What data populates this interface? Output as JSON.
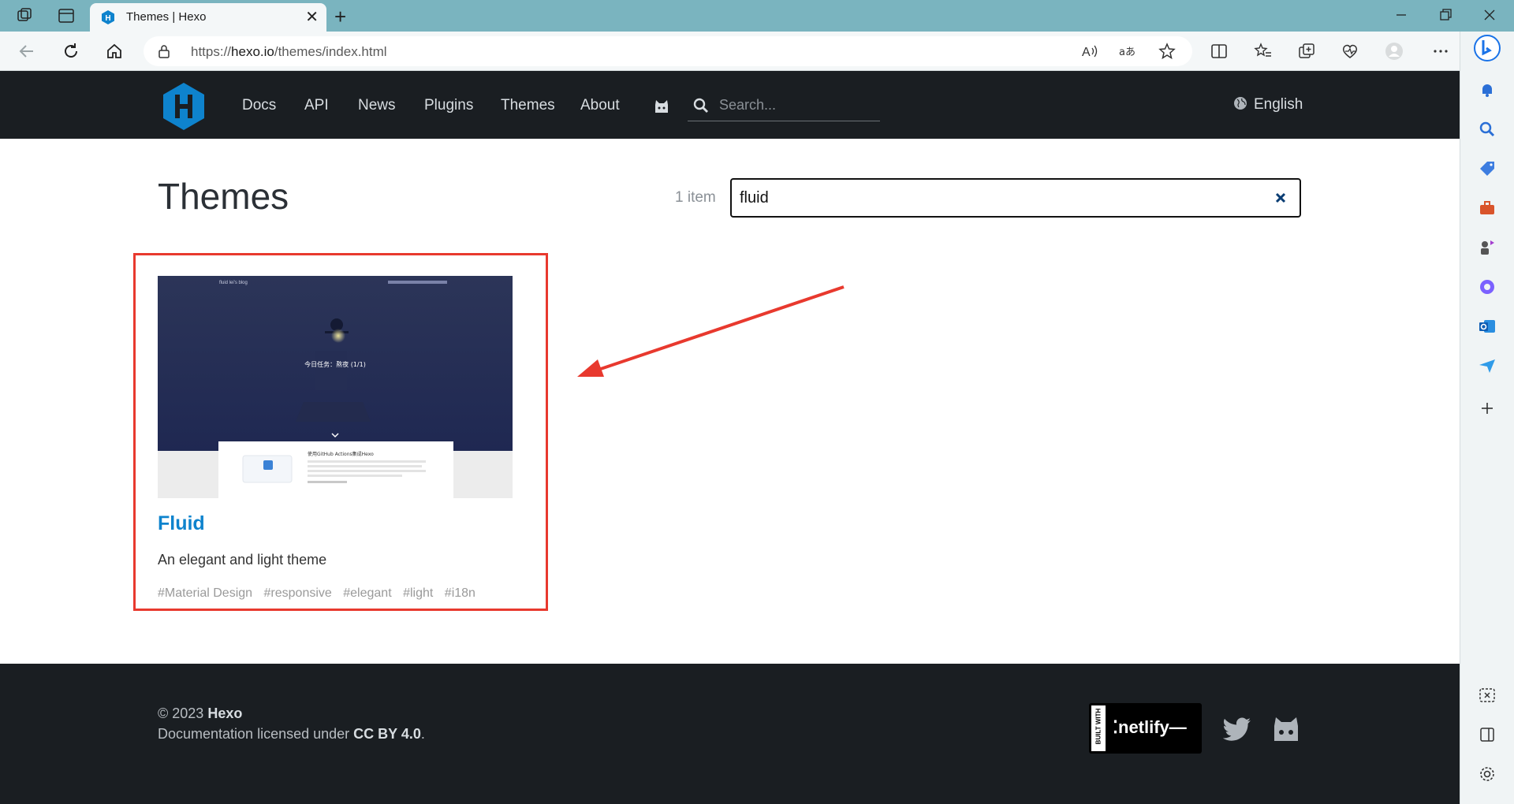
{
  "browser": {
    "tab_title": "Themes | Hexo",
    "url_prefix": "https://",
    "url_host": "hexo.io",
    "url_path": "/themes/index.html"
  },
  "site": {
    "nav": [
      "Docs",
      "API",
      "News",
      "Plugins",
      "Themes",
      "About"
    ],
    "search_placeholder": "Search...",
    "language": "English"
  },
  "main": {
    "title": "Themes",
    "count": "1 item",
    "filter_value": "fluid"
  },
  "theme_card": {
    "name": "Fluid",
    "description": "An elegant and light theme",
    "tags": [
      "#Material Design",
      "#responsive",
      "#elegant",
      "#light",
      "#i18n"
    ],
    "thumb_blog_title": "fluid lei's blog",
    "thumb_headline": "今日任务：熬夜 (1/1)",
    "thumb_post_title": "使用GitHub Actions集成Hexo"
  },
  "footer": {
    "copyright_prefix": "© 2023",
    "copyright_name": "Hexo",
    "license_prefix": "Documentation licensed under",
    "license_name": "CC BY 4.0",
    "license_suffix": ".",
    "badge_small": "BUILT WITH",
    "badge_name": "netlify"
  },
  "colors": {
    "header_bg": "#1a1e22",
    "link_blue": "#0e83cd",
    "highlight_red": "#e8392e",
    "chrome_teal": "#7ab4bf"
  }
}
